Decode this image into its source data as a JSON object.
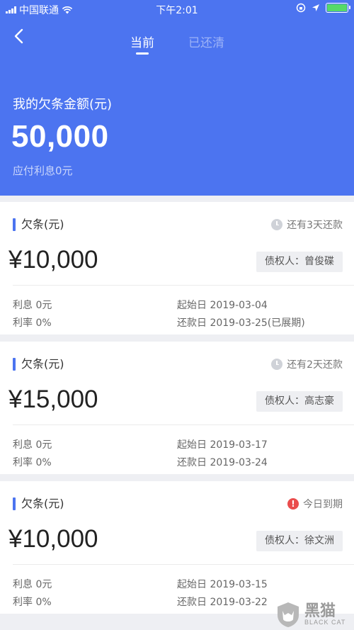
{
  "status_bar": {
    "carrier": "中国联通",
    "time": "下午2:01"
  },
  "tabs": {
    "current": "当前",
    "cleared": "已还清"
  },
  "summary": {
    "label": "我的欠条金额(元)",
    "amount": "50,000",
    "interest_due": "应付利息0元"
  },
  "loans": [
    {
      "title": "欠条(元)",
      "status": "还有3天还款",
      "status_icon": "clock-icon",
      "amount": "¥10,000",
      "creditor": "债权人：曾俊碟",
      "interest": "利息 0元",
      "rate": "利率 0%",
      "start_date": "起始日 2019-03-04",
      "repay_date": "还款日 2019-03-25(已展期)"
    },
    {
      "title": "欠条(元)",
      "status": "还有2天还款",
      "status_icon": "clock-icon",
      "amount": "¥15,000",
      "creditor": "债权人：高志豪",
      "interest": "利息 0元",
      "rate": "利率 0%",
      "start_date": "起始日 2019-03-17",
      "repay_date": "还款日 2019-03-24"
    },
    {
      "title": "欠条(元)",
      "status": "今日到期",
      "status_icon": "alert-icon",
      "amount": "¥10,000",
      "creditor": "债权人：徐文洲",
      "interest": "利息 0元",
      "rate": "利率 0%",
      "start_date": "起始日 2019-03-15",
      "repay_date": "还款日 2019-03-22"
    }
  ],
  "watermark": {
    "cn": "黑猫",
    "en": "BLACK CAT"
  },
  "colors": {
    "brand": "#4c74f0",
    "alert": "#ea4d4d",
    "battery": "#56d968"
  }
}
